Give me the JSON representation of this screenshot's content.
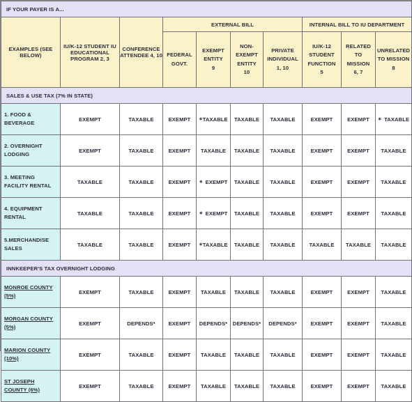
{
  "banners": {
    "payer": "IF YOUR PAYER IS A...",
    "sales_use_tax": "SALES & USE TAX  (7% IN STATE)",
    "innkeepers": "INNKEEPER'S TAX OVERNIGHT LODGING"
  },
  "header": {
    "groups": {
      "external_bill": "EXTERNAL BILL",
      "internal_bill": "INTERNAL BILL TO IU DEPARTMENT"
    },
    "columns": [
      {
        "name": "examples",
        "lines": [
          "EXAMPLES",
          "(SEE BELOW)"
        ]
      },
      {
        "name": "iu-k12-student-educational-program",
        "lines": [
          "IU/K-12 STUDENT",
          "IU EDUCATIONAL",
          "PROGRAM",
          "2, 3"
        ]
      },
      {
        "name": "conference-attendee",
        "lines": [
          "CONFERENCE",
          "ATTENDEE",
          "4, 10"
        ]
      },
      {
        "name": "federal-govt",
        "lines": [
          "FEDERAL",
          "GOVT."
        ]
      },
      {
        "name": "exempt-entity",
        "lines": [
          "EXEMPT",
          "ENTITY",
          "9"
        ]
      },
      {
        "name": "non-exempt-entity",
        "lines": [
          "NON-",
          "EXEMPT",
          "ENTITY",
          "10"
        ]
      },
      {
        "name": "private-individual",
        "lines": [
          "PRIVATE",
          "INDIVIDUAL",
          "1, 10"
        ]
      },
      {
        "name": "iu-k12-student-function",
        "lines": [
          "IU/K-12",
          "STUDENT",
          "FUNCTION",
          "5"
        ]
      },
      {
        "name": "related-to-mission",
        "lines": [
          "RELATED",
          "TO",
          "MISSION",
          "6, 7"
        ]
      },
      {
        "name": "unrelated-to-mission",
        "lines": [
          "UNRELATED",
          "TO MISSION",
          "8"
        ]
      }
    ]
  },
  "sales_use_rows": [
    {
      "label": [
        "1. FOOD &",
        "BEVERAGE"
      ],
      "underline": false,
      "values": [
        "EXEMPT",
        "TAXABLE",
        "EXEMPT",
        "✶TAXABLE",
        "TAXABLE",
        "TAXABLE",
        "EXEMPT",
        "EXEMPT",
        "✶ TAXABLE"
      ]
    },
    {
      "label": [
        "2. OVERNIGHT",
        "LODGING"
      ],
      "underline": false,
      "values": [
        "EXEMPT",
        "TAXABLE",
        "EXEMPT",
        "TAXABLE",
        "TAXABLE",
        "TAXABLE",
        "EXEMPT",
        "EXEMPT",
        "TAXABLE"
      ]
    },
    {
      "label": [
        "3. MEETING",
        "FACILITY RENTAL"
      ],
      "underline": false,
      "values": [
        "TAXABLE",
        "TAXABLE",
        "EXEMPT",
        "✶ EXEMPT",
        "TAXABLE",
        "TAXABLE",
        "EXEMPT",
        "EXEMPT",
        "TAXABLE"
      ]
    },
    {
      "label": [
        "4. EQUIPMENT",
        "RENTAL"
      ],
      "underline": false,
      "values": [
        "TAXABLE",
        "TAXABLE",
        "EXEMPT",
        "✶ EXEMPT",
        "TAXABLE",
        "TAXABLE",
        "EXEMPT",
        "EXEMPT",
        "TAXABLE"
      ]
    },
    {
      "label": [
        "5.MERCHANDISE",
        "SALES"
      ],
      "underline": false,
      "values": [
        "TAXABLE",
        "TAXABLE",
        "EXEMPT",
        "✶TAXABLE",
        "TAXABLE",
        "TAXABLE",
        "TAXABLE",
        "TAXABLE",
        "TAXABLE"
      ]
    }
  ],
  "innkeeper_rows": [
    {
      "label": [
        "MONROE COUNTY",
        "(5%)"
      ],
      "underline": true,
      "values": [
        "EXEMPT",
        "TAXABLE",
        "EXEMPT",
        "TAXABLE",
        "TAXABLE",
        "TAXABLE",
        "EXEMPT",
        "EXEMPT",
        "TAXABLE"
      ]
    },
    {
      "label": [
        "MORGAN COUNTY",
        "(5%)"
      ],
      "underline": true,
      "values": [
        "EXEMPT",
        "DEPENDS*",
        "EXEMPT",
        "DEPENDS*",
        "DEPENDS*",
        "DEPENDS*",
        "EXEMPT",
        "EXEMPT",
        "TAXABLE"
      ]
    },
    {
      "label": [
        "MARION COUNTY",
        "(10%)"
      ],
      "underline": true,
      "values": [
        "EXEMPT",
        "TAXABLE",
        "EXEMPT",
        "TAXABLE",
        "TAXABLE",
        "TAXABLE",
        "EXEMPT",
        "EXEMPT",
        "TAXABLE"
      ]
    },
    {
      "label": [
        "ST JOSEPH",
        "COUNTY (6%)"
      ],
      "underline": true,
      "values": [
        "EXEMPT",
        "TAXABLE",
        "EXEMPT",
        "TAXABLE",
        "TAXABLE",
        "TAXABLE",
        "EXEMPT",
        "EXEMPT",
        "TAXABLE"
      ]
    }
  ],
  "colors": {
    "banner_bg": "#e2e1f5",
    "header_bg": "#fbf2ca",
    "rowlabel_bg": "#d4f3f2",
    "grid_line": "#6f6f76",
    "text": "#2b2b3a"
  }
}
